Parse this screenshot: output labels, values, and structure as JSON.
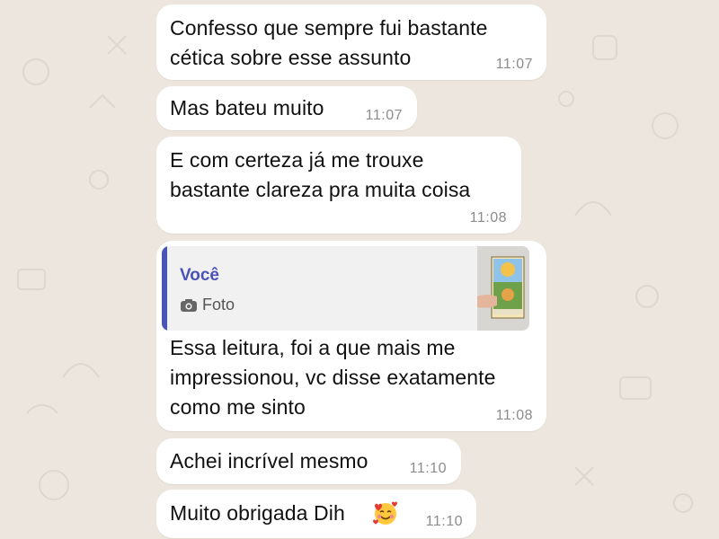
{
  "messages": [
    {
      "text": "Confesso que sempre fui bastante\ncética sobre esse assunto",
      "time": "11:07"
    },
    {
      "text": "Mas bateu muito",
      "time": "11:07"
    },
    {
      "text": "E com certeza já me trouxe\nbastante clareza pra muita coisa",
      "time": "11:08"
    },
    {
      "quote": {
        "author": "Você",
        "label": "Foto",
        "icon": "camera-icon"
      },
      "text": "Essa leitura, foi a que mais me\nimpressionou, vc disse exatamente\ncomo me sinto",
      "time": "11:08"
    },
    {
      "text": "Achei incrível mesmo",
      "time": "11:10"
    },
    {
      "text": "Muito obrigada Dih",
      "emoji": "smiling-face-with-hearts",
      "time": "11:10"
    }
  ],
  "colors": {
    "background": "#ECE6DE",
    "bubble": "#FFFFFF",
    "quote_accent": "#4A53B8",
    "timestamp": "#8C8C8C"
  }
}
